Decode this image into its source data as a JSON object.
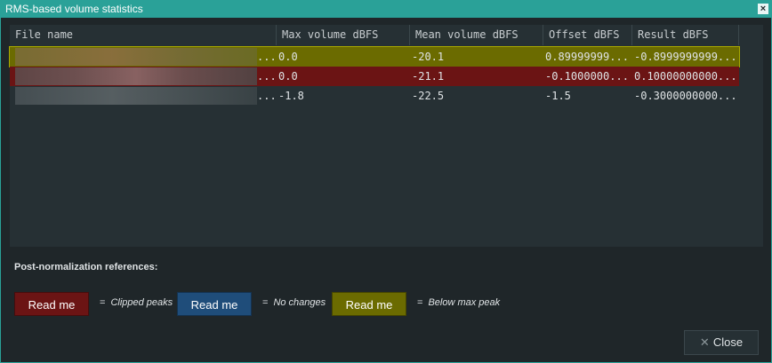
{
  "window": {
    "title": "RMS-based volume statistics",
    "close_icon": "×"
  },
  "table": {
    "columns": [
      "File name",
      "Max volume dBFS",
      "Mean volume dBFS",
      "Offset dBFS",
      "Result dBFS"
    ],
    "rows": [
      {
        "status": "below-max-peak",
        "file_suffix": "...",
        "max": "0.0",
        "mean": "-20.1",
        "offset": "0.89999999...",
        "result": "-0.8999999999..."
      },
      {
        "status": "clipped-peaks",
        "file_suffix": "...",
        "max": "0.0",
        "mean": "-21.1",
        "offset": "-0.1000000...",
        "result": "0.10000000000..."
      },
      {
        "status": "no-changes",
        "file_suffix": "...",
        "max": "-1.8",
        "mean": "-22.5",
        "offset": "-1.5",
        "result": "-0.3000000000..."
      }
    ]
  },
  "references": {
    "label": "Post-normalization references:",
    "items": [
      {
        "button": "Read me",
        "eq": "=",
        "text": "Clipped peaks",
        "color": "#6b1414"
      },
      {
        "button": "Read me",
        "eq": "=",
        "text": "No changes",
        "color": "#1f4d7a"
      },
      {
        "button": "Read me",
        "eq": "=",
        "text": "Below max peak",
        "color": "#6b6b00"
      }
    ]
  },
  "footer": {
    "close_label": "Close",
    "close_icon": "✕"
  },
  "colors": {
    "accent": "#2aa198",
    "clipped": "#6b1414",
    "no_changes": "#1f4d7a",
    "below_max": "#6b6b00"
  }
}
